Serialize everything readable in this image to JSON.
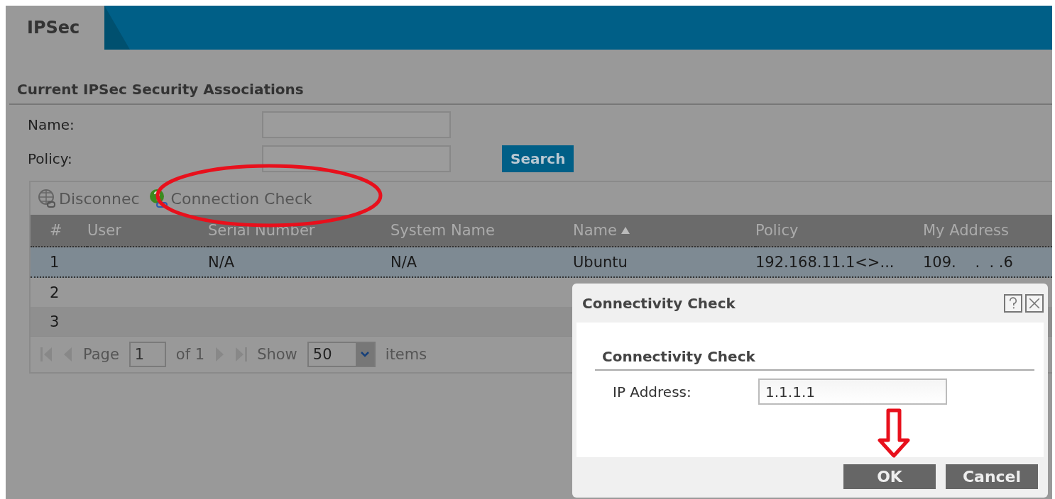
{
  "tabs": [
    {
      "label": "IPSec",
      "selected": true
    }
  ],
  "section": {
    "title": "Current IPSec Security Associations"
  },
  "search_form": {
    "fields": [
      {
        "label": "Name:"
      },
      {
        "label": "Policy:"
      }
    ],
    "button": "Search"
  },
  "toolbar": [
    {
      "label": "Disconnec",
      "kind": "disconnect"
    },
    {
      "label": "Connection Check",
      "kind": "check"
    }
  ],
  "table": {
    "columns": [
      {
        "label": "#",
        "sorted": false
      },
      {
        "label": "User",
        "sorted": false
      },
      {
        "label": "Serial Number",
        "sorted": false
      },
      {
        "label": "System Name",
        "sorted": false
      },
      {
        "label": "Name",
        "sorted": true
      },
      {
        "label": "Policy",
        "sorted": false
      },
      {
        "label": "My Address",
        "sorted": false
      }
    ],
    "rows": [
      {
        "selected": true,
        "cells": [
          "1",
          null,
          "N/A",
          "N/A",
          "Ubuntu",
          "192.168.11.1<>...",
          "109.    .  . .6"
        ]
      },
      {
        "selected": false,
        "cells": [
          "2",
          null,
          null,
          null,
          null,
          null,
          null
        ]
      },
      {
        "selected": false,
        "cells": [
          "3",
          null,
          null,
          null,
          null,
          null,
          null
        ]
      }
    ]
  },
  "pager": {
    "page_label": "Page",
    "page": "1",
    "of": "of 1",
    "show_label": "Show",
    "show": "50",
    "items_label": "items"
  },
  "dialog": {
    "title": "Connectivity Check",
    "section": "Connectivity Check",
    "field_label": "IP Address:",
    "field_value": "1.1.1.1",
    "buttons": [
      "OK",
      "Cancel"
    ]
  }
}
